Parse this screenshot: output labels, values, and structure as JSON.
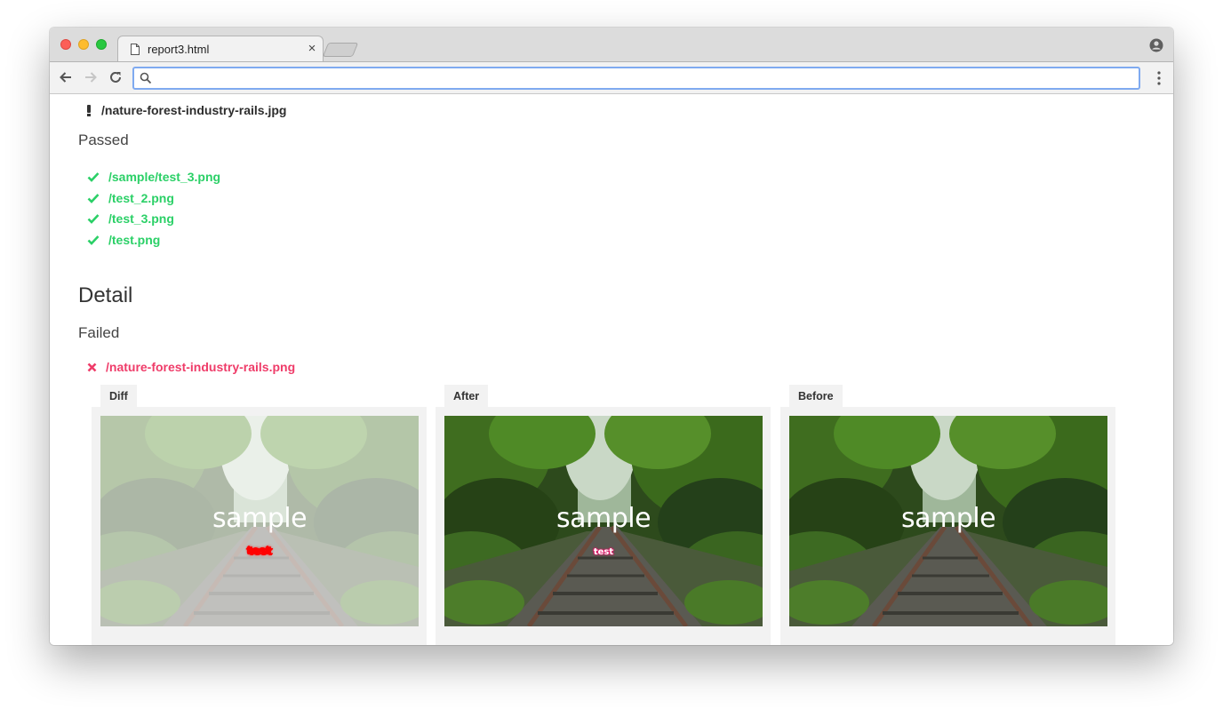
{
  "browser": {
    "tab_title": "report3.html",
    "tab_close": "×",
    "address_value": "",
    "address_placeholder": ""
  },
  "report": {
    "warning_file": "/nature-forest-industry-rails.jpg",
    "passed_heading": "Passed",
    "passed_items": [
      "/sample/test_3.png",
      "/test_2.png",
      "/test_3.png",
      "/test.png"
    ],
    "detail_heading": "Detail",
    "failed_heading": "Failed",
    "failed_file": "/nature-forest-industry-rails.png",
    "panels": [
      {
        "label": "Diff",
        "overlay_title": "sample",
        "overlay_marker": "test"
      },
      {
        "label": "After",
        "overlay_title": "sample",
        "overlay_marker": "test"
      },
      {
        "label": "Before",
        "overlay_title": "sample"
      }
    ]
  },
  "colors": {
    "passed": "#2bd067",
    "failed": "#ef3c69",
    "omnibox_focus": "#7faaf0",
    "diff_marker": "#ff0000"
  },
  "icons": {
    "warning": "exclamation-icon",
    "passed": "check-icon",
    "failed": "cross-icon"
  }
}
